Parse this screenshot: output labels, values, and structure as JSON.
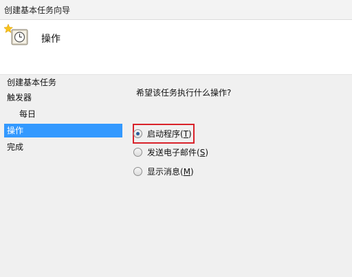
{
  "window": {
    "title": "创建基本任务向导"
  },
  "header": {
    "title": "操作",
    "icon": "task-clock-icon"
  },
  "nav": {
    "items": [
      {
        "label": "创建基本任务",
        "selected": false
      },
      {
        "label": "触发器",
        "selected": false
      },
      {
        "label": "每日",
        "selected": false,
        "sub": true
      },
      {
        "label": "操作",
        "selected": true
      },
      {
        "label": "完成",
        "selected": false
      }
    ]
  },
  "main": {
    "question": "希望该任务执行什么操作?",
    "options": [
      {
        "label": "启动程序(",
        "access_key": "T",
        "label_end": ")",
        "checked": true
      },
      {
        "label": "发送电子邮件(",
        "access_key": "S",
        "label_end": ")",
        "checked": false
      },
      {
        "label": "显示消息(",
        "access_key": "M",
        "label_end": ")",
        "checked": false
      }
    ]
  },
  "colors": {
    "selection": "#3399ff",
    "highlight_border": "#d9222a"
  }
}
